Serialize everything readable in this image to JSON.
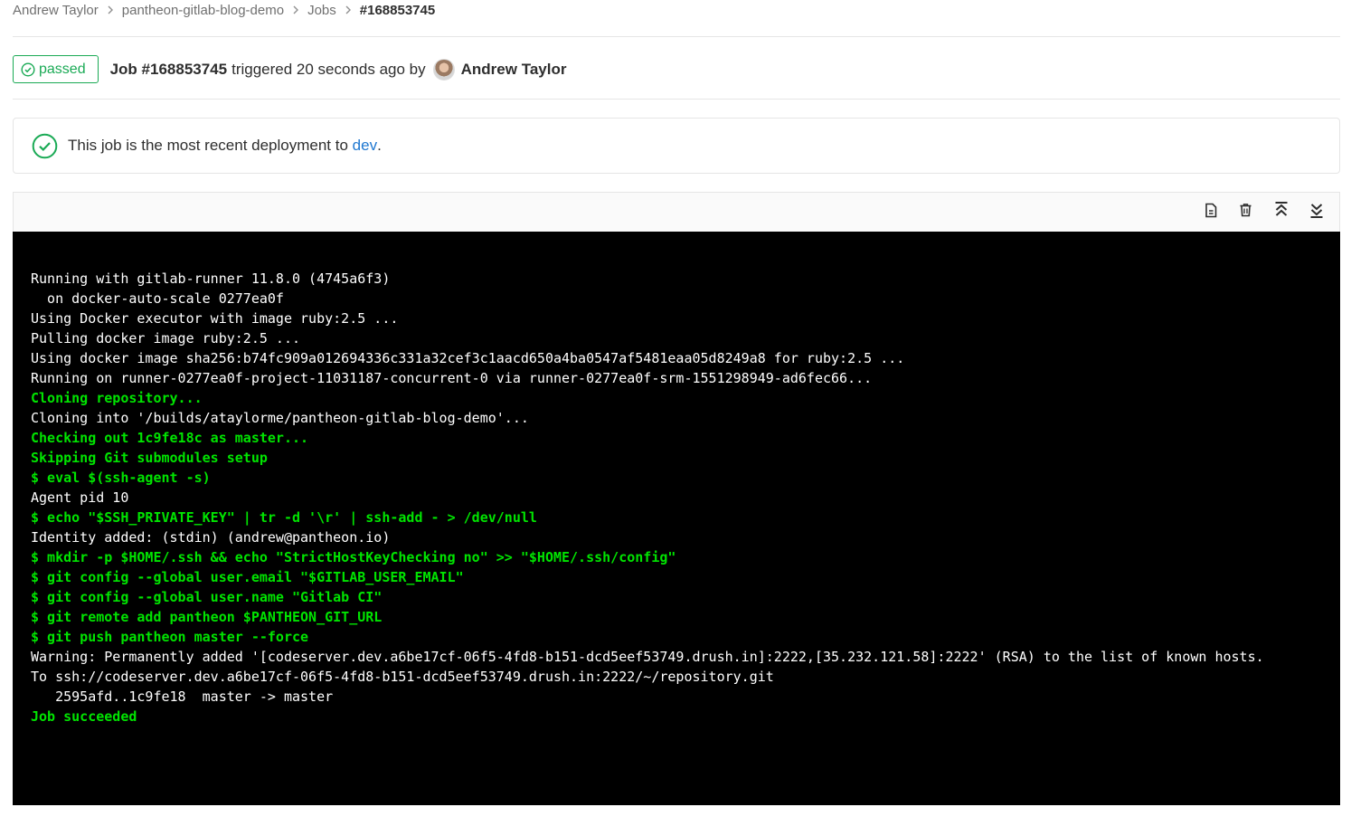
{
  "breadcrumb": {
    "items": [
      "Andrew Taylor",
      "pantheon-gitlab-blog-demo",
      "Jobs",
      "#168853745"
    ]
  },
  "header": {
    "status": "passed",
    "job_title": "Job #168853745",
    "meta": "triggered 20 seconds ago by",
    "author": "Andrew Taylor"
  },
  "deployment": {
    "text": "This job is the most recent deployment to",
    "env": "dev",
    "suffix": "."
  },
  "toolbar": {
    "icons": [
      "raw-log-icon",
      "erase-log-icon",
      "scroll-top-icon",
      "scroll-bottom-icon"
    ]
  },
  "colors": {
    "success": "#1aaa55",
    "link": "#1f78d1",
    "log_bg": "#000000",
    "log_green": "#00e400"
  },
  "log": {
    "lines": [
      {
        "text": "Running with gitlab-runner 11.8.0 (4745a6f3)",
        "style": "normal"
      },
      {
        "text": "  on docker-auto-scale 0277ea0f",
        "style": "normal"
      },
      {
        "text": "Using Docker executor with image ruby:2.5 ...",
        "style": "normal"
      },
      {
        "text": "Pulling docker image ruby:2.5 ...",
        "style": "normal"
      },
      {
        "text": "Using docker image sha256:b74fc909a012694336c331a32cef3c1aacd650a4ba0547af5481eaa05d8249a8 for ruby:2.5 ...",
        "style": "normal"
      },
      {
        "text": "Running on runner-0277ea0f-project-11031187-concurrent-0 via runner-0277ea0f-srm-1551298949-ad6fec66...",
        "style": "normal"
      },
      {
        "text": "Cloning repository...",
        "style": "green"
      },
      {
        "text": "Cloning into '/builds/ataylorme/pantheon-gitlab-blog-demo'...",
        "style": "normal"
      },
      {
        "text": "Checking out 1c9fe18c as master...",
        "style": "green"
      },
      {
        "text": "Skipping Git submodules setup",
        "style": "green"
      },
      {
        "text": "$ eval $(ssh-agent -s)",
        "style": "green"
      },
      {
        "text": "Agent pid 10",
        "style": "normal"
      },
      {
        "text": "$ echo \"$SSH_PRIVATE_KEY\" | tr -d '\\r' | ssh-add - > /dev/null",
        "style": "green"
      },
      {
        "text": "Identity added: (stdin) (andrew@pantheon.io)",
        "style": "normal"
      },
      {
        "text": "$ mkdir -p $HOME/.ssh && echo \"StrictHostKeyChecking no\" >> \"$HOME/.ssh/config\"",
        "style": "green"
      },
      {
        "text": "$ git config --global user.email \"$GITLAB_USER_EMAIL\"",
        "style": "green"
      },
      {
        "text": "$ git config --global user.name \"Gitlab CI\"",
        "style": "green"
      },
      {
        "text": "$ git remote add pantheon $PANTHEON_GIT_URL",
        "style": "green"
      },
      {
        "text": "$ git push pantheon master --force",
        "style": "green"
      },
      {
        "text": "Warning: Permanently added '[codeserver.dev.a6be17cf-06f5-4fd8-b151-dcd5eef53749.drush.in]:2222,[35.232.121.58]:2222' (RSA) to the list of known hosts.",
        "style": "normal"
      },
      {
        "text": "To ssh://codeserver.dev.a6be17cf-06f5-4fd8-b151-dcd5eef53749.drush.in:2222/~/repository.git",
        "style": "normal"
      },
      {
        "text": "   2595afd..1c9fe18  master -> master",
        "style": "normal"
      },
      {
        "text": "Job succeeded",
        "style": "green"
      }
    ]
  }
}
